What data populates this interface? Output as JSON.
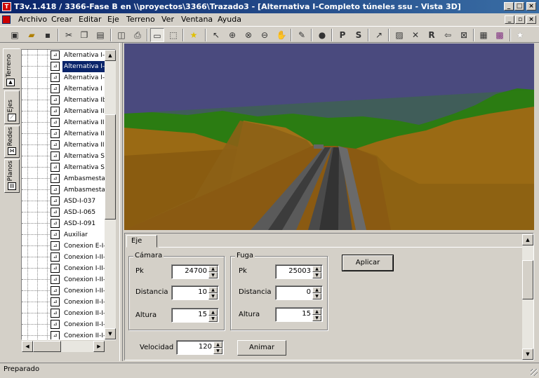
{
  "window": {
    "title": "T3v.1.418 / 3366-Fase B en \\\\proyectos\\3366\\Trazado3 - [Alternativa I-Completo túneles ssu - Vista 3D]",
    "buttons": {
      "minimize": "_",
      "maximize": "□",
      "close": "×"
    }
  },
  "menu": {
    "items": [
      "Archivo",
      "Crear",
      "Editar",
      "Eje",
      "Terreno",
      "Ver",
      "Ventana",
      "Ayuda"
    ],
    "mdi_buttons": {
      "minimize": "_",
      "restore": "▫",
      "close": "×"
    }
  },
  "toolbar": {
    "icons": [
      "new-window-icon",
      "open-folder-icon",
      "save-icon",
      "cut-icon",
      "copy-icon",
      "paste-icon",
      "print-preview-icon",
      "print-icon",
      "view-3d-icon",
      "zoom-window-icon",
      "star-icon",
      "pointer-icon",
      "zoom-in-icon",
      "zoom-extents-icon",
      "zoom-out-icon",
      "pan-hand-icon",
      "draw-icon",
      "sphere-icon",
      "profile-icon",
      "section-icon",
      "pointer-info-icon",
      "hatch-icon",
      "cross-icon",
      "redraw-icon",
      "arrow-left-icon",
      "delete-icon",
      "grid-table-icon",
      "palette-icon",
      "star-white-icon"
    ],
    "letter_buttons": {
      "p": "P",
      "s": "S",
      "r": "R"
    }
  },
  "side_tabs": [
    {
      "label": "Terreno",
      "active": true
    },
    {
      "label": "Ejes",
      "active": false
    },
    {
      "label": "Redes",
      "active": false
    },
    {
      "label": "Planos",
      "active": false
    }
  ],
  "tree": {
    "selected_index": 1,
    "items": [
      "Alternativa I-tú",
      "Alternativa I-C",
      "Alternativa I-C",
      "Alternativa I",
      "Alternativa Ib",
      "Alternativa II",
      "Alternativa IIb",
      "Alternativa IIc",
      "Alternativa III",
      "Alternativa Se",
      "Alternativa Se",
      "Ambasmesta",
      "Ambasmesta",
      "ASD-I-037",
      "ASD-I-065",
      "ASD-I-091",
      "Auxiliar",
      "Conexion E-I-",
      "Conexion I-II-(",
      "Conexion I-II-(",
      "Conexion I-II-(",
      "Conexion I-II-(",
      "Conexion II-I-(",
      "Conexion II-I-(",
      "Conexion II-I-(",
      "Conexion II-I-("
    ]
  },
  "panel": {
    "tab": "Eje",
    "camara": {
      "legend": "Cámara",
      "pk_label": "Pk",
      "pk": "24700",
      "distancia_label": "Distancia",
      "distancia": "10",
      "altura_label": "Altura",
      "altura": "15"
    },
    "fuga": {
      "legend": "Fuga",
      "pk_label": "Pk",
      "pk": "25003",
      "distancia_label": "Distancia",
      "distancia": "0",
      "altura_label": "Altura",
      "altura": "15"
    },
    "apply_button": "Aplicar",
    "velocidad_label": "Velocidad",
    "velocidad": "120",
    "animate_button": "Animar"
  },
  "status": {
    "text": "Preparado"
  },
  "colors": {
    "sky": "#4a4a7e",
    "grass": "#2a7a12",
    "terrain": "#9a6a14",
    "road": "#4a4a4a",
    "title_start": "#0a246a",
    "title_end": "#3a6ea5"
  }
}
